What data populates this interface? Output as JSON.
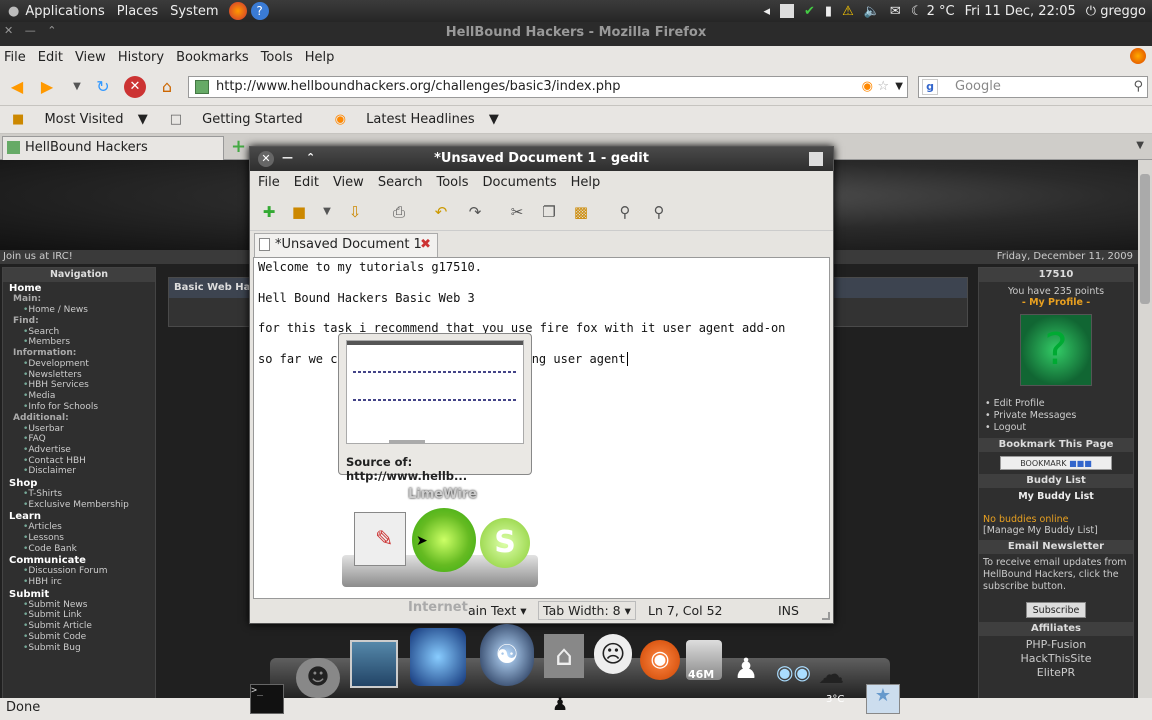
{
  "top_panel": {
    "menus": [
      "Applications",
      "Places",
      "System"
    ],
    "weather": "2 °C",
    "clock": "Fri 11 Dec, 22:05",
    "user": "greggo"
  },
  "firefox": {
    "window_title": "HellBound Hackers - Mozilla Firefox",
    "menu": [
      "File",
      "Edit",
      "View",
      "History",
      "Bookmarks",
      "Tools",
      "Help"
    ],
    "url": "http://www.hellboundhackers.org/challenges/basic3/index.php",
    "search_placeholder": "Google",
    "bookmarks": [
      "Most Visited",
      "Getting Started",
      "Latest Headlines"
    ],
    "tab_title": "HellBound Hackers",
    "status": "Done"
  },
  "site": {
    "irc_text": "Join us at IRC!",
    "date_text": "Friday, December 11, 2009",
    "center_heading": "Basic Web Hac",
    "nav_title": "Navigation",
    "nav": [
      {
        "type": "sec",
        "label": "Home"
      },
      {
        "type": "sub",
        "label": "Main:"
      },
      {
        "type": "lnk",
        "label": "Home / News"
      },
      {
        "type": "sub",
        "label": "Find:"
      },
      {
        "type": "lnk",
        "label": "Search"
      },
      {
        "type": "lnk",
        "label": "Members"
      },
      {
        "type": "sub",
        "label": "Information:"
      },
      {
        "type": "lnk",
        "label": "Development"
      },
      {
        "type": "lnk",
        "label": "Newsletters"
      },
      {
        "type": "lnk",
        "label": "HBH Services"
      },
      {
        "type": "lnk",
        "label": "Media"
      },
      {
        "type": "lnk",
        "label": "Info for Schools"
      },
      {
        "type": "sub",
        "label": "Additional:"
      },
      {
        "type": "lnk",
        "label": "Userbar"
      },
      {
        "type": "lnk",
        "label": "FAQ"
      },
      {
        "type": "lnk",
        "label": "Advertise"
      },
      {
        "type": "lnk",
        "label": "Contact HBH"
      },
      {
        "type": "lnk",
        "label": "Disclaimer"
      },
      {
        "type": "sec",
        "label": "Shop"
      },
      {
        "type": "lnk",
        "label": "T-Shirts"
      },
      {
        "type": "lnk",
        "label": "Exclusive Membership"
      },
      {
        "type": "sec",
        "label": "Learn"
      },
      {
        "type": "lnk",
        "label": "Articles"
      },
      {
        "type": "lnk",
        "label": "Lessons"
      },
      {
        "type": "lnk",
        "label": "Code Bank"
      },
      {
        "type": "sec",
        "label": "Communicate"
      },
      {
        "type": "lnk",
        "label": "Discussion Forum"
      },
      {
        "type": "lnk",
        "label": "HBH irc"
      },
      {
        "type": "sec",
        "label": "Submit"
      },
      {
        "type": "lnk",
        "label": "Submit News"
      },
      {
        "type": "lnk",
        "label": "Submit Link"
      },
      {
        "type": "lnk",
        "label": "Submit Article"
      },
      {
        "type": "lnk",
        "label": "Submit Code"
      },
      {
        "type": "lnk",
        "label": "Submit Bug"
      }
    ],
    "profile": {
      "user_id": "17510",
      "points_text": "You have 235 points",
      "my_profile": "- My Profile -",
      "links": [
        "Edit Profile",
        "Private Messages",
        "Logout"
      ]
    },
    "bookmark_page": "Bookmark This Page",
    "bookmark_button": "BOOKMARK",
    "buddy": {
      "title": "Buddy List",
      "subtitle": "My Buddy List",
      "status": "No buddies online",
      "manage": "[Manage My Buddy List]"
    },
    "newsletter": {
      "title": "Email Newsletter",
      "text": "To receive email updates from HellBound Hackers, click the subscribe button.",
      "button": "Subscribe"
    },
    "affiliates": {
      "title": "Affiliates",
      "items": [
        "PHP-Fusion",
        "HackThisSite",
        "ElitePR"
      ]
    }
  },
  "gedit": {
    "title": "*Unsaved Document 1 - gedit",
    "menu": [
      "File",
      "Edit",
      "View",
      "Search",
      "Tools",
      "Documents",
      "Help"
    ],
    "tab": "*Unsaved Document 1",
    "lines": [
      "Welcome to my tutorials g17510.",
      "Hell Bound Hackers Basic Web 3",
      "for this task i recommend that you use fire fox with it user agent add-on",
      "so far we ca",
      "ng user agent"
    ],
    "status_lang": "ain Text",
    "tab_width": "Tab Width:  8",
    "cursor_pos": "Ln 7, Col 52",
    "mode": "INS"
  },
  "popup": {
    "caption": "Source of: http://www.hellb..."
  },
  "dock": {
    "app_label_top": "LimeWire",
    "app_label_bottom": "Internet",
    "trash_size": "46M",
    "weather_small": "3°C"
  },
  "colors": {
    "site_bg": "#202020",
    "accent_green": "#99cc33",
    "link_orange": "#e8a020"
  }
}
